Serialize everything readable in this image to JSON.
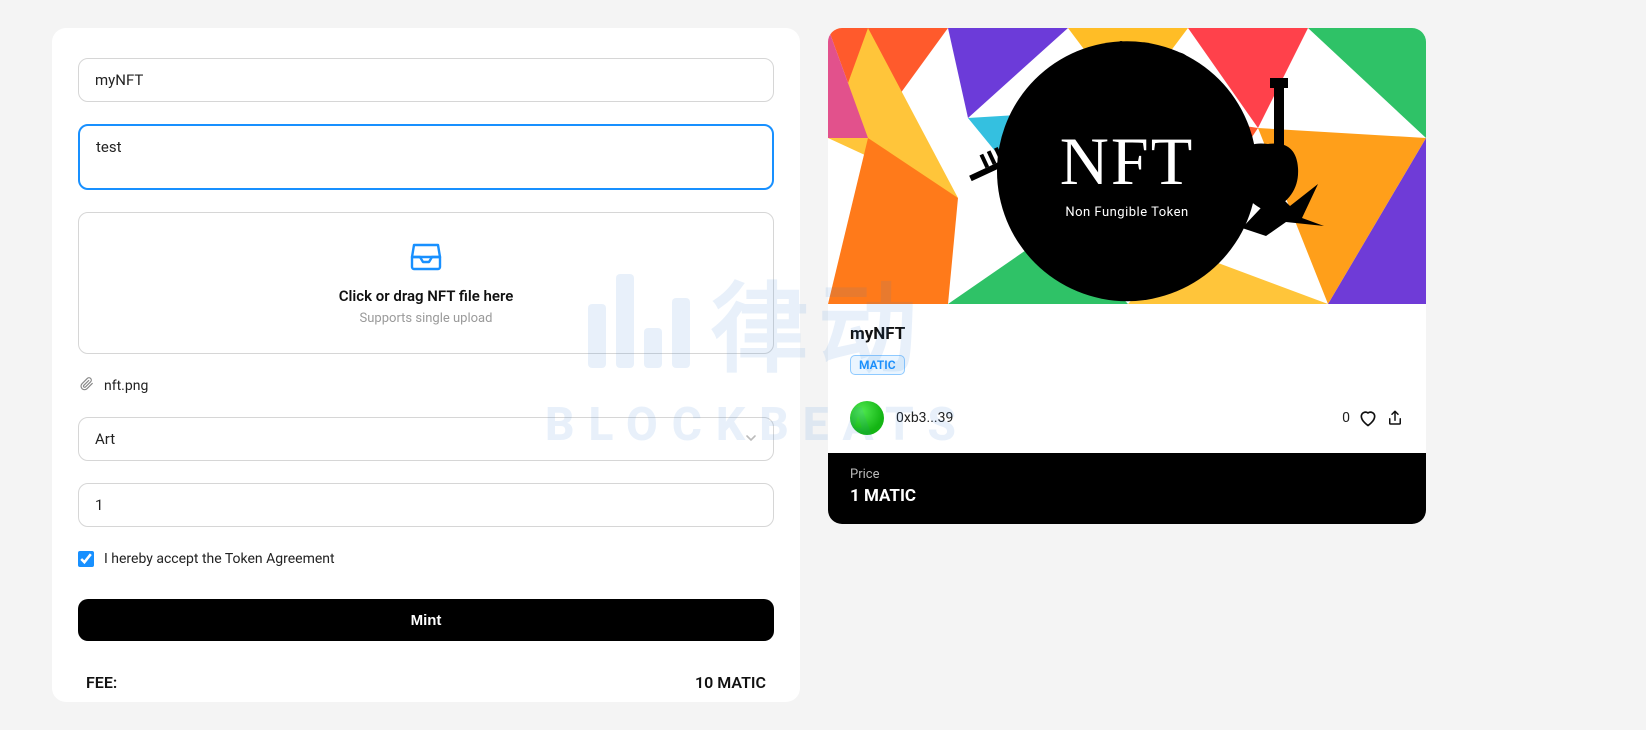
{
  "form": {
    "name_value": "myNFT",
    "description_value": "test",
    "dropzone_title": "Click or drag NFT file here",
    "dropzone_subtitle": "Supports single upload",
    "attached_file": "nft.png",
    "category_value": "Art",
    "quantity_value": "1",
    "agreement_label": "I hereby accept the Token Agreement",
    "agreement_checked": true,
    "mint_button_label": "Mint",
    "fee_label": "FEE:",
    "fee_value": "10 MATIC"
  },
  "preview": {
    "image_logo_text": "NFT",
    "image_logo_subtitle": "Non Fungible Token",
    "title": "myNFT",
    "chain_badge": "MATIC",
    "owner_address": "0xb3...39",
    "likes_count": "0",
    "price_label": "Price",
    "price_value": "1 MATIC"
  },
  "watermark": {
    "cn": "律动",
    "en": "BLOCKBEATS"
  }
}
